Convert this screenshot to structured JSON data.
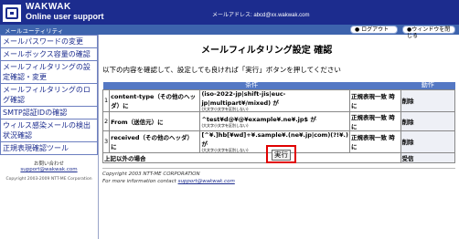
{
  "header": {
    "brand_name": "WAKWAK",
    "brand_tagline": "Online user support",
    "address_label": "メールアドレス: abcd@xx.wakwak.com"
  },
  "subbar": {
    "title": "メールユーティリティ",
    "logout_label": "● ログアウト",
    "close_label": "●ウィンドウを閉じる"
  },
  "sidebar": {
    "items": [
      {
        "label": "メールパスワードの変更"
      },
      {
        "label": "メールボックス容量の確認"
      },
      {
        "label": "メールフィルタリングの設定確認・変更"
      },
      {
        "label": "メールフィルタリングのログ確認"
      },
      {
        "label": "SMTP認証IDの確認"
      },
      {
        "label": "ウィルス感染メールの検出状況確認"
      },
      {
        "label": "正規表現確認ツール"
      }
    ],
    "contact_label": "お問い合わせ",
    "contact_email": "support@wakwak.com",
    "copyright": "Copyright 2003-2009 NTT-ME Corporation"
  },
  "main": {
    "title": "メールフィルタリング設定 確認",
    "intro": "以下の内容を確認して、設定しても良ければ「実行」ボタンを押してください",
    "columns": {
      "condition": "条件",
      "action": "動作"
    },
    "rules": [
      {
        "num": "1",
        "field": "content-type（その他のヘッダ）に",
        "pattern": "(iso-2022-jp|shift-jis|euc-jp|multipart¥/mixed) が",
        "note": "(大文字小文字を区別しない)",
        "match": "正規表現一致 時に",
        "action": "削除"
      },
      {
        "num": "2",
        "field": "From（送信元）に",
        "pattern": "^test¥d@¥@¥example¥.ne¥.jp$ が",
        "note": "(大文字小文字を区別しない)",
        "match": "正規表現一致 時に",
        "action": "削除"
      },
      {
        "num": "3",
        "field": "received（その他のヘッダ）に",
        "pattern": "[^¥.]hb[¥wd]+¥.sample¥.(ne¥.jp|com)(?!¥.) が",
        "note": "(大文字小文字を区別しない)",
        "match": "正規表現一致 時に",
        "action": "削除"
      }
    ],
    "summary": {
      "label": "上記以外の場合",
      "action": "受信"
    },
    "execute_label": "実行",
    "footer_copyright": "Copyright 2003 NTT-ME CORPORATION",
    "footer_contact_prefix": "For more information contact",
    "footer_contact_email": "support@wakwak.com"
  },
  "colors": {
    "header_bg": "#1c2c8e",
    "subbar_bg": "#3d63ad",
    "table_header_bg": "#5478c4",
    "execute_highlight": "#e00000"
  }
}
